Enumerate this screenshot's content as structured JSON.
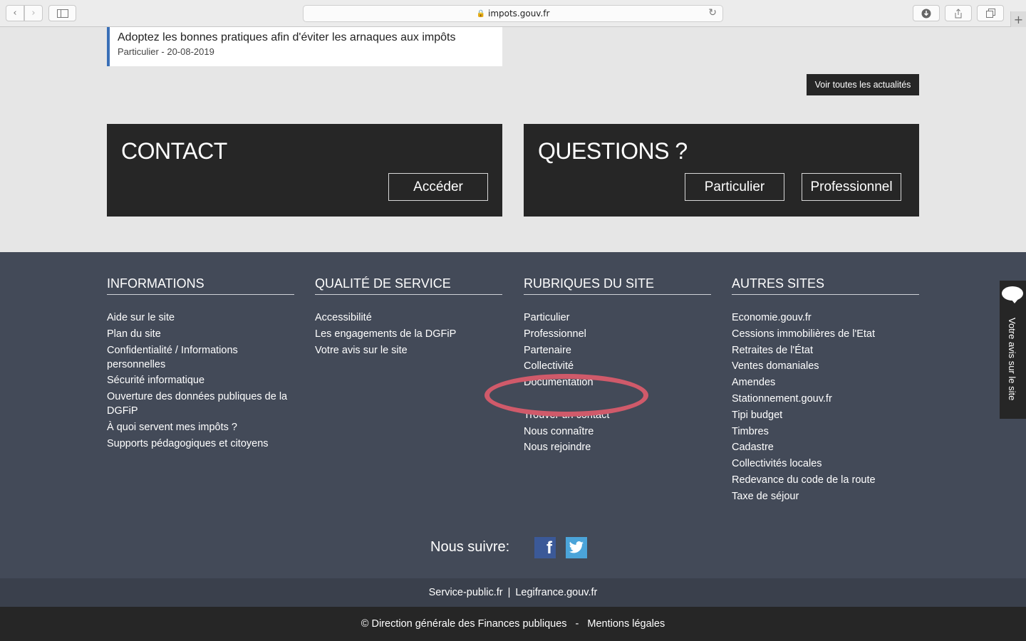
{
  "browser": {
    "url": "impots.gouv.fr"
  },
  "news": {
    "title": "Adoptez les bonnes pratiques afin d'éviter les arnaques aux impôts",
    "meta": "Particulier - 20-08-2019",
    "all_news_label": "Voir toutes les actualités"
  },
  "contact": {
    "title": "CONTACT",
    "button": "Accéder"
  },
  "questions": {
    "title": "QUESTIONS ?",
    "button_particulier": "Particulier",
    "button_professionnel": "Professionnel"
  },
  "footer": {
    "informations": {
      "heading": "INFORMATIONS",
      "items": [
        "Aide sur le site",
        "Plan du site",
        "Confidentialité / Informations personnelles",
        "Sécurité informatique",
        "Ouverture des données publiques de la DGFiP",
        "À quoi servent mes impôts ?",
        "Supports pédagogiques et citoyens"
      ]
    },
    "qualite": {
      "heading": "QUALITÉ DE SERVICE",
      "items": [
        "Accessibilité",
        "Les engagements de la DGFiP",
        "Votre avis sur le site"
      ]
    },
    "rubriques": {
      "heading": "RUBRIQUES DU SITE",
      "items": [
        "Particulier",
        "Professionnel",
        "Partenaire",
        "Collectivité",
        "Documentation",
        "",
        "Trouver un contact",
        "Nous connaître",
        "Nous rejoindre"
      ]
    },
    "autres": {
      "heading": "AUTRES SITES",
      "items": [
        "Economie.gouv.fr",
        "Cessions immobilières de l'Etat",
        "Retraites de l'État",
        "Ventes domaniales",
        "Amendes",
        "Stationnement.gouv.fr",
        "Tipi budget",
        "Timbres",
        "Cadastre",
        "Collectivités locales",
        "Redevance du code de la route",
        "Taxe de séjour"
      ]
    },
    "follow_label": "Nous suivre:",
    "links": [
      "Service-public.fr",
      "Legifrance.gouv.fr"
    ],
    "link_separator": "|",
    "copyright": "© Direction générale des Finances publiques",
    "copyright_separator": "-",
    "legal": "Mentions légales"
  },
  "feedback": {
    "label": "Votre avis sur le site"
  },
  "colors": {
    "footer_bg": "#434a58",
    "dark_box": "#262626",
    "highlight": "#d05a6a",
    "news_accent": "#3a6fb7"
  }
}
